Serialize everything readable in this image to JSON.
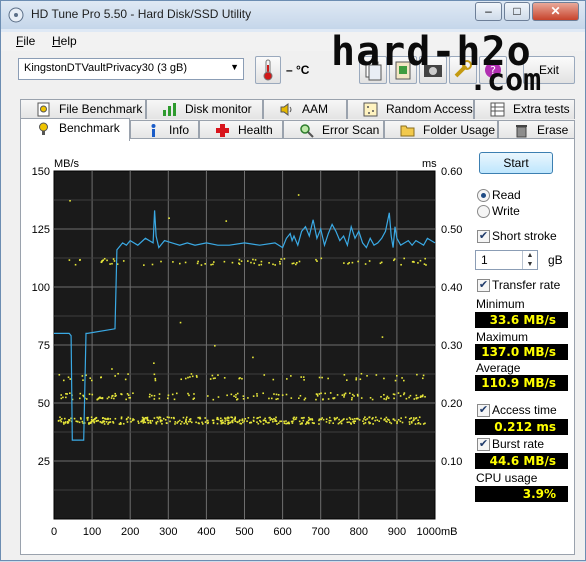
{
  "window": {
    "title": "HD Tune Pro 5.50 - Hard Disk/SSD Utility",
    "minimize": "–",
    "maximize": "□",
    "close": "✕"
  },
  "menu": [
    {
      "accel": "F",
      "rest": "ile"
    },
    {
      "accel": "H",
      "rest": "elp"
    }
  ],
  "toolbar": {
    "drive": "KingstonDTVaultPrivacy30 (3 gB)",
    "temperature": "– °C",
    "exit": "Exit"
  },
  "watermark": {
    "line1": "hard-h2o",
    "line2": ".com"
  },
  "tabs_top": [
    "File Benchmark",
    "Disk monitor",
    "AAM",
    "Random Access",
    "Extra tests"
  ],
  "tabs_bottom": [
    "Benchmark",
    "Info",
    "Health",
    "Error Scan",
    "Folder Usage",
    "Erase"
  ],
  "active_tab": "Benchmark",
  "controls": {
    "start": "Start",
    "read": "Read",
    "write": "Write",
    "read_selected": true,
    "short_stroke": "Short stroke",
    "short_stroke_checked": true,
    "short_stroke_value": "1",
    "short_stroke_unit": "gB",
    "transfer_rate": "Transfer rate",
    "transfer_rate_checked": true,
    "access_time": "Access time",
    "access_time_checked": true,
    "burst_rate": "Burst rate",
    "burst_rate_checked": true
  },
  "stats": {
    "minimum_label": "Minimum",
    "minimum": "33.6 MB/s",
    "maximum_label": "Maximum",
    "maximum": "137.0 MB/s",
    "average_label": "Average",
    "average": "110.9 MB/s",
    "access_time": "0.212 ms",
    "burst_rate": "44.6 MB/s",
    "cpu_label": "CPU usage",
    "cpu": "3.9%"
  },
  "chart_data": {
    "type": "line",
    "ylabel_left": "MB/s",
    "ylabel_right": "ms",
    "x_unit": "mB",
    "xlim": [
      0,
      1000
    ],
    "ylim_left": [
      0,
      150
    ],
    "ylim_right": [
      0,
      0.6
    ],
    "x_ticks": [
      "0",
      "100",
      "200",
      "300",
      "400",
      "500",
      "600",
      "700",
      "800",
      "900",
      "1000mB"
    ],
    "y_ticks_left": [
      "150",
      "125",
      "100",
      "75",
      "50",
      "25"
    ],
    "y_ticks_right": [
      "0.60",
      "0.50",
      "0.40",
      "0.30",
      "0.20",
      "0.10"
    ],
    "grid": true,
    "background": "#1a1a1a",
    "colors": {
      "transfer": "#3aa9e4",
      "access": "#e8e83a"
    },
    "series": [
      {
        "type": "line",
        "x": [
          0,
          40,
          45,
          48,
          78,
          84,
          88,
          160,
          165,
          180,
          190,
          200,
          220,
          240,
          260,
          264,
          268,
          275,
          290,
          310,
          330,
          350,
          370,
          400,
          430,
          460,
          500,
          540,
          580,
          600,
          610,
          620,
          625,
          630,
          640,
          650,
          660,
          670,
          680,
          690,
          700,
          710,
          720,
          730,
          740,
          750,
          760,
          770,
          780,
          790,
          800,
          810,
          820,
          830,
          840,
          850,
          860,
          870,
          880,
          885,
          890,
          895,
          900,
          910,
          920,
          930,
          940,
          950,
          960,
          970,
          980,
          990,
          1000
        ],
        "y": [
          80,
          80,
          79,
          34,
          34,
          80,
          80,
          82,
          116,
          119,
          118,
          120,
          118,
          121,
          119,
          133,
          122,
          117,
          120,
          119,
          118,
          119,
          118,
          119,
          118,
          118,
          119,
          118,
          119,
          117,
          121,
          123,
          120,
          122,
          118,
          124,
          126,
          122,
          129,
          121,
          125,
          118,
          123,
          127,
          124,
          120,
          122,
          118,
          126,
          121,
          124,
          119,
          117,
          121,
          118,
          119,
          121,
          124,
          132,
          122,
          117,
          126,
          121,
          118,
          119,
          120,
          118,
          120,
          119,
          118,
          121,
          120,
          119
        ]
      },
      {
        "type": "scatter",
        "clusters": [
          {
            "y": 0.171,
            "x_from": 10,
            "x_to": 980,
            "count": 420
          },
          {
            "y": 0.213,
            "x_from": 10,
            "x_to": 980,
            "count": 150
          },
          {
            "y": 0.246,
            "x_from": 10,
            "x_to": 980,
            "count": 60
          },
          {
            "y": 0.445,
            "x_from": 10,
            "x_to": 980,
            "count": 80
          }
        ],
        "outliers": [
          {
            "x": 40,
            "y": 0.55
          },
          {
            "x": 300,
            "y": 0.52
          },
          {
            "x": 450,
            "y": 0.515
          },
          {
            "x": 330,
            "y": 0.34
          },
          {
            "x": 860,
            "y": 0.315
          },
          {
            "x": 150,
            "y": 0.26
          },
          {
            "x": 520,
            "y": 0.28
          },
          {
            "x": 760,
            "y": 0.25
          },
          {
            "x": 640,
            "y": 0.56
          },
          {
            "x": 420,
            "y": 0.3
          },
          {
            "x": 260,
            "y": 0.27
          }
        ]
      }
    ]
  }
}
